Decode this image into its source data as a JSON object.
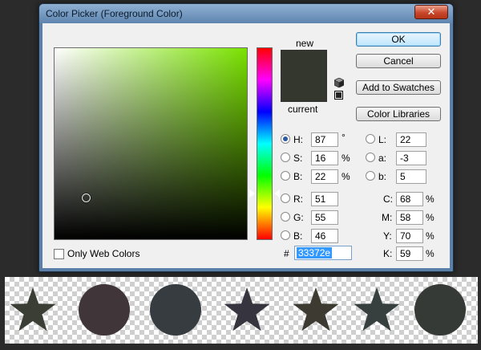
{
  "window": {
    "title": "Color Picker (Foreground Color)",
    "close_glyph": "✕"
  },
  "preview": {
    "new_label": "new",
    "current_label": "current",
    "new_color": "#33372e",
    "current_color": "#33372e"
  },
  "buttons": {
    "ok": "OK",
    "cancel": "Cancel",
    "add_to_swatches": "Add to Swatches",
    "color_libraries": "Color Libraries"
  },
  "hsb": {
    "h": {
      "label": "H:",
      "value": "87",
      "unit": "°",
      "selected": true
    },
    "s": {
      "label": "S:",
      "value": "16",
      "unit": "%"
    },
    "b": {
      "label": "B:",
      "value": "22",
      "unit": "%"
    }
  },
  "rgb": {
    "r": {
      "label": "R:",
      "value": "51"
    },
    "g": {
      "label": "G:",
      "value": "55"
    },
    "b": {
      "label": "B:",
      "value": "46"
    }
  },
  "lab": {
    "l": {
      "label": "L:",
      "value": "22"
    },
    "a": {
      "label": "a:",
      "value": "-3"
    },
    "b": {
      "label": "b:",
      "value": "5"
    }
  },
  "cmyk": {
    "c": {
      "label": "C:",
      "value": "68",
      "unit": "%"
    },
    "m": {
      "label": "M:",
      "value": "58",
      "unit": "%"
    },
    "y": {
      "label": "Y:",
      "value": "70",
      "unit": "%"
    },
    "k": {
      "label": "K:",
      "value": "59",
      "unit": "%"
    }
  },
  "hex": {
    "label": "#",
    "value": "33372e"
  },
  "only_web_colors": {
    "label": "Only Web Colors",
    "checked": false
  },
  "hue_color": "#7ae200",
  "canvas_shapes": [
    {
      "kind": "star",
      "color": "#3a3e35",
      "icon": "star-icon"
    },
    {
      "kind": "circle",
      "color": "#403538",
      "icon": "circle-icon"
    },
    {
      "kind": "circle",
      "color": "#363c40",
      "icon": "circle-icon"
    },
    {
      "kind": "star",
      "color": "#36353f",
      "icon": "star-icon"
    },
    {
      "kind": "star",
      "color": "#3c3a31",
      "icon": "star-icon"
    },
    {
      "kind": "star",
      "color": "#373f3f",
      "icon": "star-icon"
    },
    {
      "kind": "circle",
      "color": "#353a36",
      "icon": "circle-icon"
    }
  ]
}
